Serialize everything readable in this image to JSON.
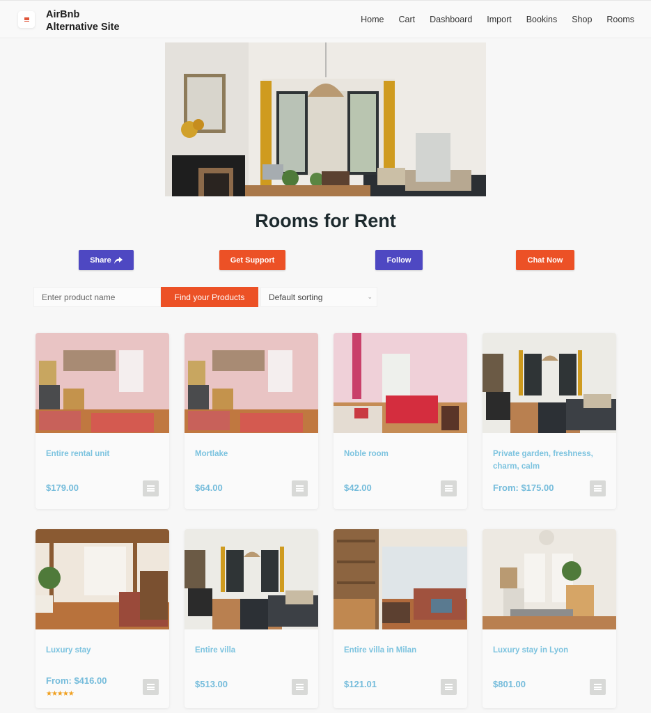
{
  "header": {
    "brand_line1": "AirBnb",
    "brand_line2": "Alternative Site",
    "menu_icon": "hamburger-icon",
    "nav": [
      "Home",
      "Cart",
      "Dashboard",
      "Import",
      "Bookins",
      "Shop",
      "Rooms"
    ]
  },
  "hero": {
    "alt": "Living room with fireplace, rattan pendant lamp, yellow curtains and grey sofa"
  },
  "page_title": "Rooms for Rent",
  "actions": {
    "share": "Share",
    "share_icon": "share-arrow-icon",
    "support": "Get Support",
    "follow": "Follow",
    "chat": "Chat Now"
  },
  "search": {
    "placeholder": "Enter product name",
    "value": "",
    "button": "Find your Products",
    "sort_selected": "Default sorting"
  },
  "colors": {
    "purple": "#4e48c2",
    "orange": "#ec5126",
    "link_blue": "#7cc3df",
    "star": "#f0a020"
  },
  "products": [
    {
      "title": "Entire rental unit",
      "price": "$179.00",
      "rating": null
    },
    {
      "title": "Mortlake",
      "price": "$64.00",
      "rating": null
    },
    {
      "title": "Noble room",
      "price": "$42.00",
      "rating": null
    },
    {
      "title": "Private garden, freshness, charm, calm",
      "price": "From: $175.00",
      "rating": null
    },
    {
      "title": "Luxury stay",
      "price": "From: $416.00",
      "rating": "★★★★★"
    },
    {
      "title": "Entire villa",
      "price": "$513.00",
      "rating": null
    },
    {
      "title": "Entire villa in Milan",
      "price": "$121.01",
      "rating": null
    },
    {
      "title": "Luxury stay in Lyon",
      "price": "$801.00",
      "rating": null
    }
  ]
}
